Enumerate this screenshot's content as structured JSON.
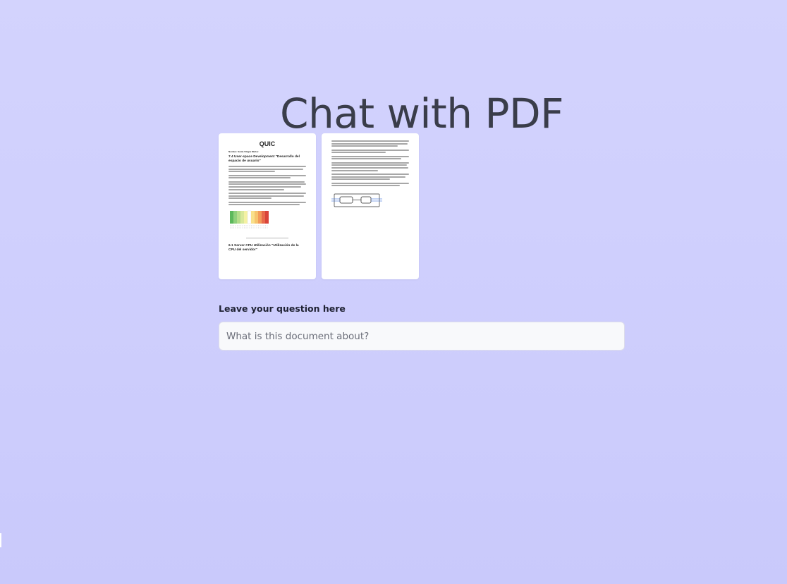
{
  "header": {
    "title": "Chat with PDF"
  },
  "pdf": {
    "pages": [
      {
        "heading": "QUIC",
        "author": "Nombre: Santa Vilagra Muñoz",
        "section_1": "7.4 User-space Development \"Desarrollo del espacio de usuario\"",
        "section_2": "6.1 Server CPU Utilización \"Utilización de la CPU del servidor\""
      },
      {
        "section_1": "",
        "section_2": ""
      }
    ]
  },
  "question": {
    "label": "Leave your question here",
    "placeholder": "What is this document about?",
    "value": ""
  }
}
